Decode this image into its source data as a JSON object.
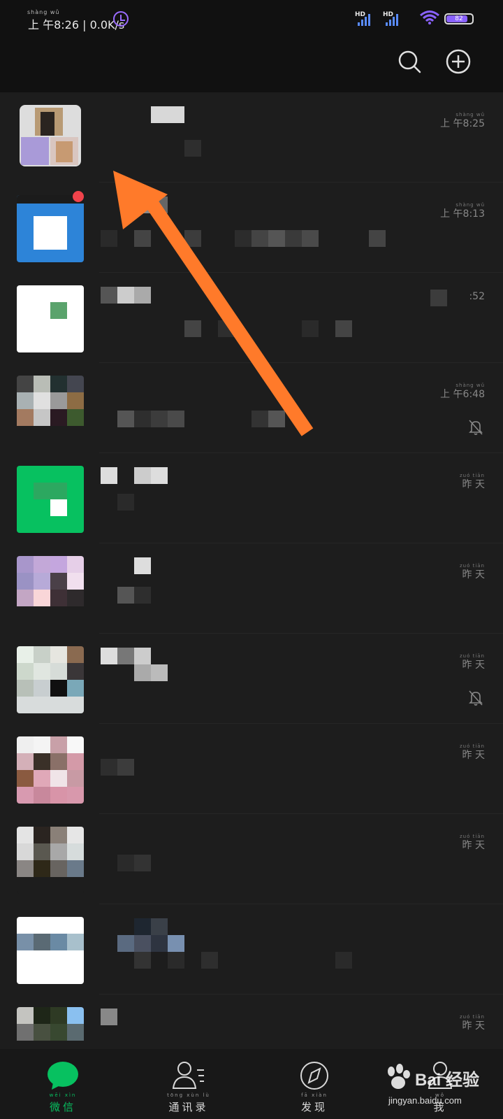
{
  "status_bar": {
    "time_pinyin": "shàng wǔ",
    "time": "上 午8:26 | 0.0K/s",
    "hd1": "HD",
    "hd2": "HD",
    "battery": "82",
    "battery_level": 0.82
  },
  "header": {
    "search_icon": "search-icon",
    "add_icon": "plus-circle-icon"
  },
  "chats": [
    {
      "time_pinyin": "shàng wǔ",
      "time": "上 午8:25",
      "muted": false
    },
    {
      "time_pinyin": "shàng wǔ",
      "time": "上 午8:13",
      "muted": false,
      "unread_dot": true
    },
    {
      "time_pinyin": "",
      "time": ":52",
      "muted": false
    },
    {
      "time_pinyin": "shàng wǔ",
      "time": "上 午6:48",
      "muted": true
    },
    {
      "time_pinyin": "zuó tiān",
      "time": "昨 天",
      "muted": false
    },
    {
      "time_pinyin": "zuó tiān",
      "time": "昨 天",
      "muted": false
    },
    {
      "time_pinyin": "zuó tiān",
      "time": "昨 天",
      "muted": true
    },
    {
      "time_pinyin": "zuó tiān",
      "time": "昨 天",
      "muted": false
    },
    {
      "time_pinyin": "zuó tiān",
      "time": "昨 天",
      "muted": false
    },
    {
      "time_pinyin": "",
      "time": "",
      "muted": false
    },
    {
      "time_pinyin": "zuó tiān",
      "time": "昨 天",
      "muted": false
    }
  ],
  "tabbar": {
    "tabs": [
      {
        "pinyin": "wēi xìn",
        "label": "微信",
        "icon": "chat-bubble-icon",
        "active": true
      },
      {
        "pinyin": "tōng xùn lù",
        "label": "通讯录",
        "icon": "contacts-icon",
        "active": false
      },
      {
        "pinyin": "fā xiàn",
        "label": "发现",
        "icon": "compass-icon",
        "active": false
      },
      {
        "pinyin": "wǒ",
        "label": "我",
        "icon": "person-icon",
        "active": false
      }
    ]
  },
  "watermark": {
    "brand": "Bai 经验",
    "url": "jingyan.baidu.com"
  },
  "colors": {
    "accent": "#07c160",
    "arrow": "#ff7a2a",
    "background": "#1b1b1b"
  }
}
